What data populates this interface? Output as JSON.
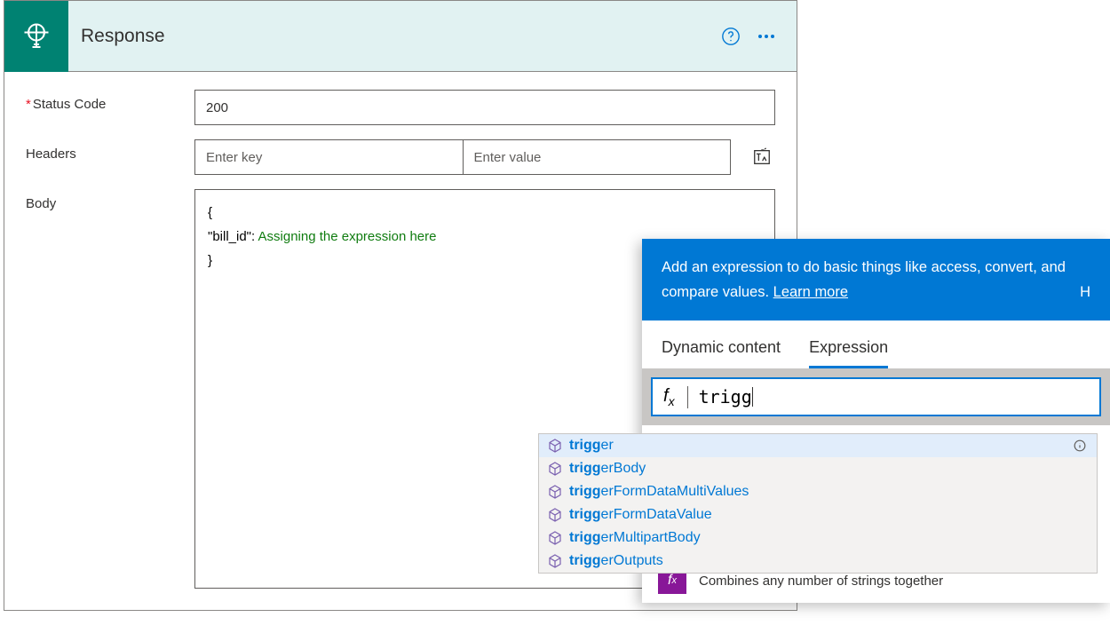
{
  "card": {
    "title": "Response",
    "statusCodeLabel": "Status Code",
    "statusCodeValue": "200",
    "headersLabel": "Headers",
    "headerKeyPlaceholder": "Enter key",
    "headerValuePlaceholder": "Enter value",
    "bodyLabel": "Body",
    "bodyLine1": "{",
    "bodyLine2Prefix": "\"bill_id\":  ",
    "bodyLine2Expr": "Assigning the expression here",
    "bodyLine3": "}"
  },
  "exprPanel": {
    "bannerText": "Add an expression to do basic things like access, convert, and compare values. ",
    "bannerLink": "Learn more",
    "bannerTail": "H",
    "tabDynamic": "Dynamic content",
    "tabExpression": "Expression",
    "fxLabel": "fx",
    "inputValue": "trigg",
    "bottomDesc": "Combines any number of strings together"
  },
  "intellisense": {
    "prefix": "trigg",
    "items": [
      {
        "completion": "er"
      },
      {
        "completion": "erBody"
      },
      {
        "completion": "erFormDataMultiValues"
      },
      {
        "completion": "erFormDataValue"
      },
      {
        "completion": "erMultipartBody"
      },
      {
        "completion": "erOutputs"
      }
    ]
  }
}
